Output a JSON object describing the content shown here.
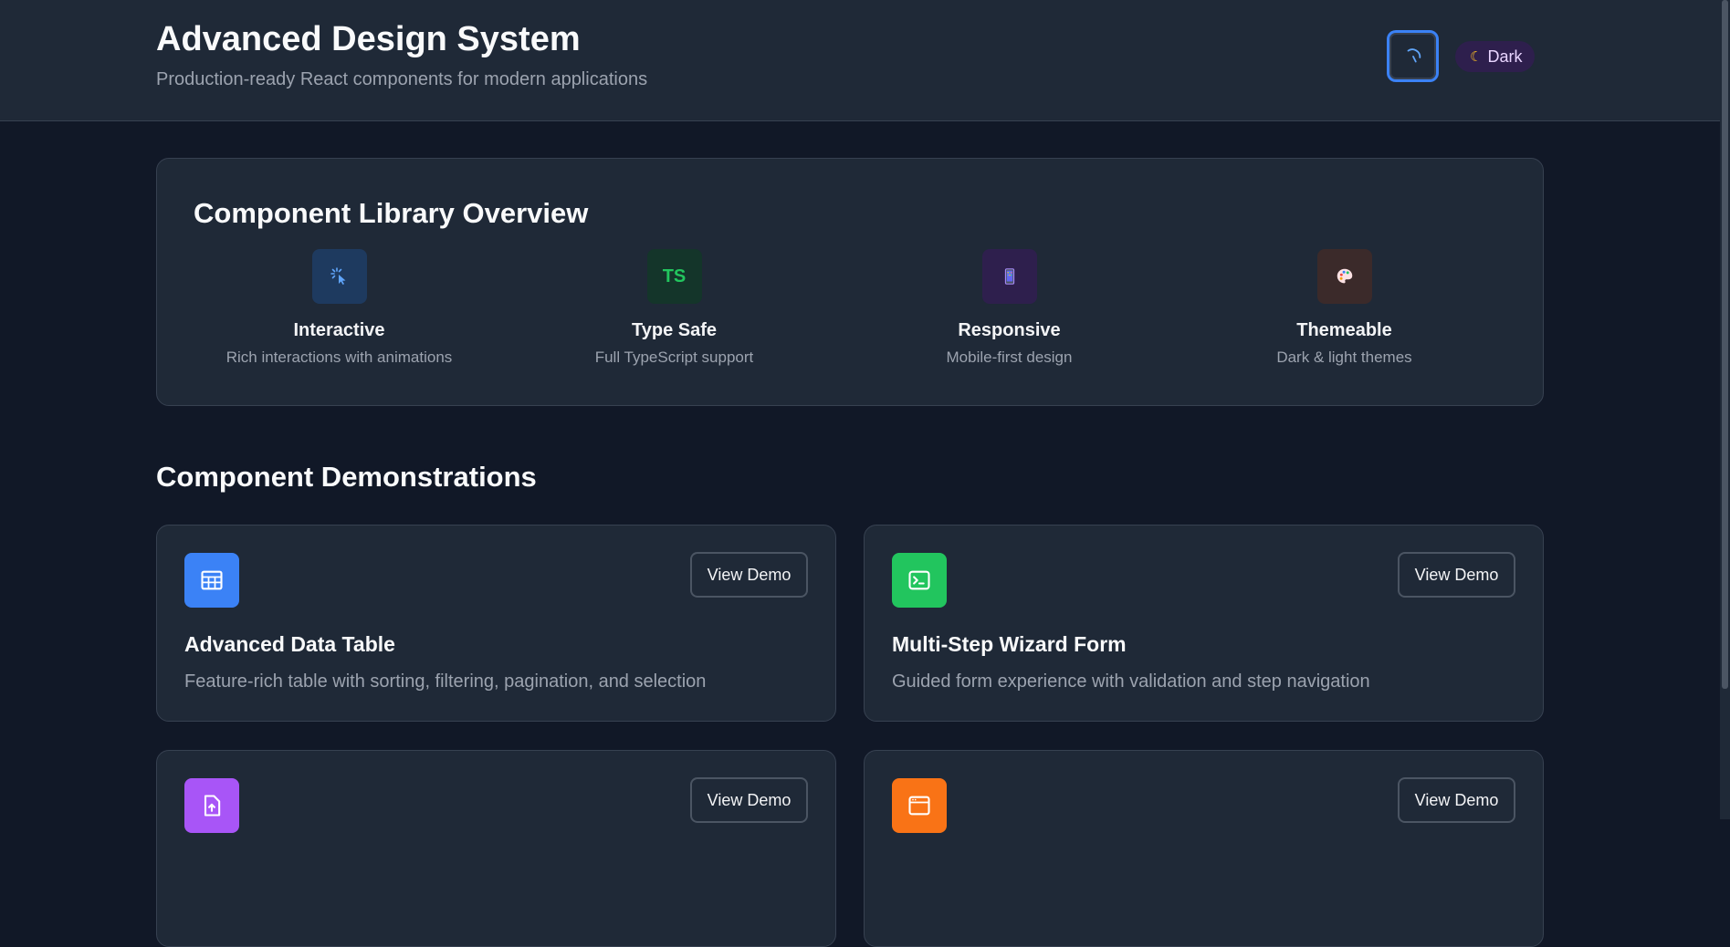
{
  "header": {
    "title": "Advanced Design System",
    "subtitle": "Production-ready React components for modern applications",
    "theme_badge": "Dark",
    "refresh_icon": "refresh-icon",
    "moon_icon": "moon-icon"
  },
  "overview": {
    "title": "Component Library Overview",
    "features": [
      {
        "title": "Interactive",
        "description": "Rich interactions with animations",
        "icon": "pointer-click-icon",
        "icon_text": "",
        "color": "#60a5fa",
        "bg": "#1e3a5f"
      },
      {
        "title": "Type Safe",
        "description": "Full TypeScript support",
        "icon": "typescript-icon",
        "icon_text": "TS",
        "color": "#22c55e",
        "bg": "#14352a"
      },
      {
        "title": "Responsive",
        "description": "Mobile-first design",
        "icon": "mobile-phone-icon",
        "icon_text": "",
        "color": "#a78bfa",
        "bg": "#2e1f4d"
      },
      {
        "title": "Themeable",
        "description": "Dark & light themes",
        "icon": "palette-icon",
        "icon_text": "",
        "color": "#f9a8d4",
        "bg": "#3b2a2a"
      }
    ]
  },
  "demos": {
    "section_title": "Component Demonstrations",
    "button_label": "View Demo",
    "cards": [
      {
        "title": "Advanced Data Table",
        "description": "Feature-rich table with sorting, filtering, pagination, and selection",
        "icon": "table-icon",
        "color": "#3b82f6"
      },
      {
        "title": "Multi-Step Wizard Form",
        "description": "Guided form experience with validation and step navigation",
        "icon": "terminal-icon",
        "color": "#22c55e"
      },
      {
        "title": "",
        "description": "",
        "icon": "file-upload-icon",
        "color": "#a855f7"
      },
      {
        "title": "",
        "description": "",
        "icon": "browser-window-icon",
        "color": "#f97316"
      }
    ]
  }
}
